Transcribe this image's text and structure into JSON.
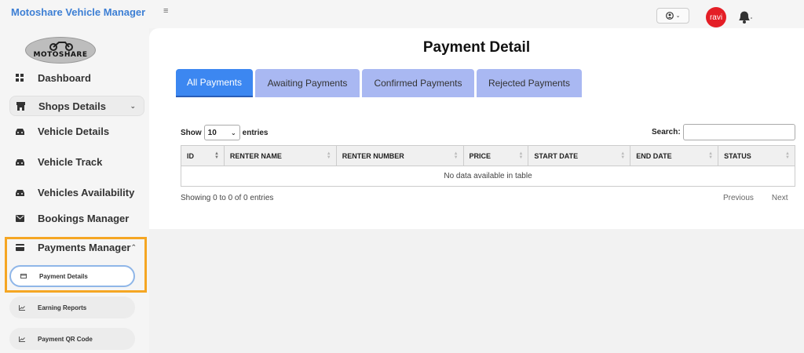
{
  "app": {
    "title": "Motoshare Vehicle Manager",
    "logo_text": "MOTOSHARE"
  },
  "sidebar": {
    "items": [
      {
        "label": "Dashboard",
        "icon": "grid-icon"
      },
      {
        "label": "Shops Details",
        "icon": "store-icon",
        "expandable": true
      },
      {
        "label": "Vehicle Details",
        "icon": "car-icon"
      },
      {
        "label": "Vehicle Track",
        "icon": "car-icon"
      },
      {
        "label": "Vehicles Availability",
        "icon": "car-icon"
      },
      {
        "label": "Bookings Manager",
        "icon": "envelope-icon"
      },
      {
        "label": "Payments Manager",
        "icon": "credit-card-icon",
        "expanded": true
      }
    ],
    "subitems": [
      {
        "label": "Payment Details",
        "icon": "card-icon",
        "active": true
      },
      {
        "label": "Earning Reports",
        "icon": "chart-icon"
      },
      {
        "label": "Payment QR Code",
        "icon": "chart-icon"
      }
    ]
  },
  "topbar": {
    "menu_icon": "≡",
    "user_menu_icon": "user-circle-icon",
    "avatar_text": "ravi",
    "notification_icon": "bell-icon"
  },
  "main": {
    "title": "Payment Detail",
    "tabs": [
      {
        "label": "All Payments",
        "active": true
      },
      {
        "label": "Awaiting Payments"
      },
      {
        "label": "Confirmed Payments"
      },
      {
        "label": "Rejected Payments"
      }
    ],
    "table": {
      "show_label": "Show",
      "entries_value": "10",
      "entries_label": "entries",
      "search_label": "Search:",
      "search_value": "",
      "columns": [
        "ID",
        "RENTER NAME",
        "RENTER NUMBER",
        "PRICE",
        "START DATE",
        "END DATE",
        "STATUS"
      ],
      "empty_text": "No data available in table",
      "info": "Showing 0 to 0 of 0 entries",
      "previous": "Previous",
      "next": "Next"
    }
  },
  "colors": {
    "brand": "#3d7fd4",
    "tab_active": "#3c87f1",
    "tab_inactive": "#a9b8f2",
    "highlight": "#f5a623",
    "avatar": "#e41e26"
  }
}
